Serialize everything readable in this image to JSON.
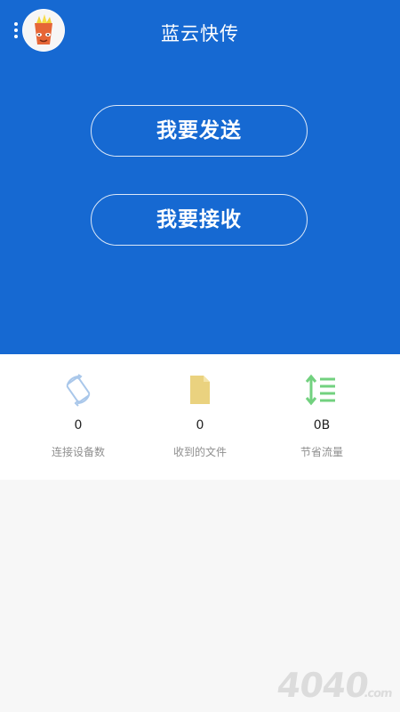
{
  "header": {
    "title": "蓝云快传"
  },
  "actions": {
    "send_label": "我要发送",
    "receive_label": "我要接收"
  },
  "stats": [
    {
      "value": "0",
      "label": "连接设备数",
      "icon": "rotate-device-icon"
    },
    {
      "value": "0",
      "label": "收到的文件",
      "icon": "file-icon"
    },
    {
      "value": "0B",
      "label": "节省流量",
      "icon": "data-list-icon"
    }
  ],
  "colors": {
    "hero": "#1669d2",
    "device_icon": "#a9c7ea",
    "file_icon": "#ead27f",
    "traffic_icon": "#72d17f"
  },
  "watermark": {
    "text": "4040",
    "suffix": ".com"
  }
}
